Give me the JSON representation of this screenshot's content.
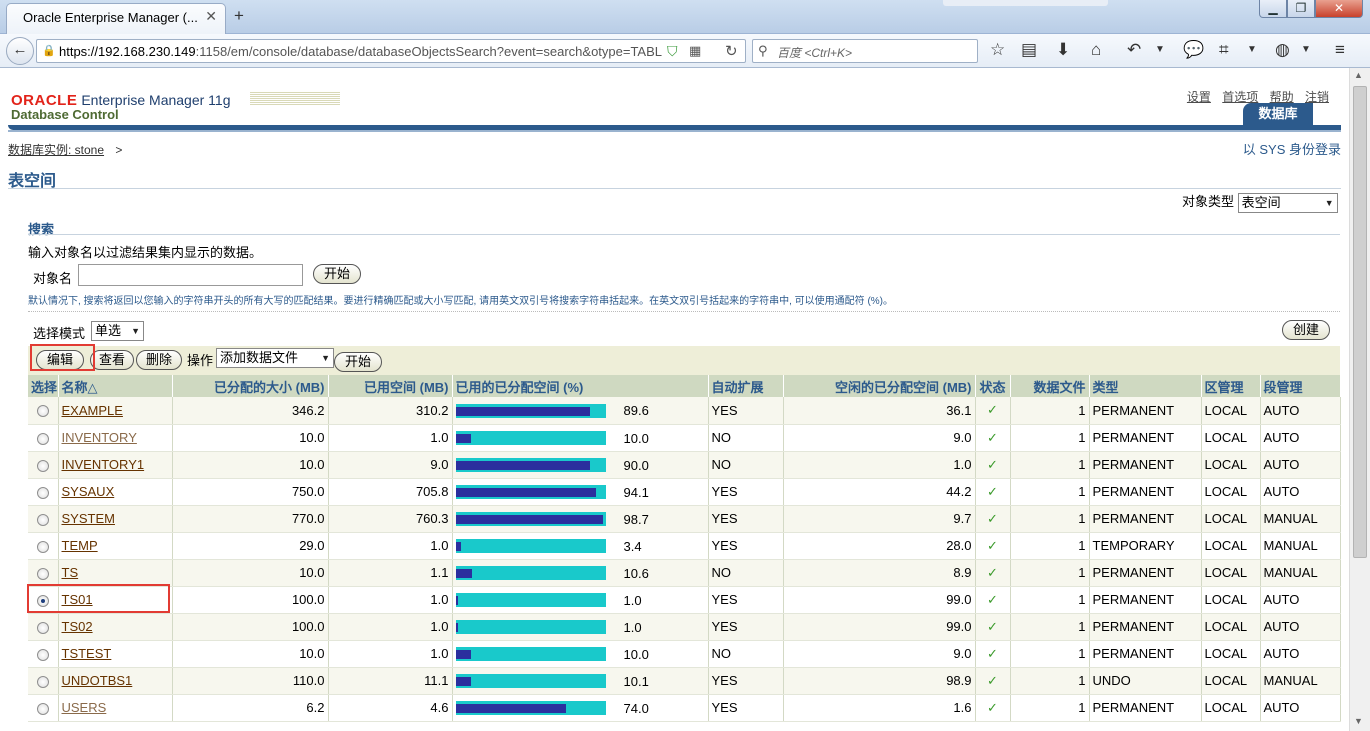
{
  "browser": {
    "tab_title": "Oracle Enterprise Manager (...",
    "url_host": "https://192.168.230.149",
    "url_rest": ":1158/em/console/database/databaseObjectsSearch?event=search&otype=TABL",
    "search_placeholder": "百度 <Ctrl+K>"
  },
  "header": {
    "brand_oracle": "ORACLE",
    "brand_em": "Enterprise Manager 11g",
    "brand_sub": "Database Control",
    "global_links": [
      "设置",
      "首选项",
      "帮助",
      "注销"
    ],
    "db_tab": "数据库"
  },
  "breadcrumb": {
    "link": "数据库实例: stone",
    "sep": ">"
  },
  "login_as": "以 SYS 身份登录",
  "page_title": "表空间",
  "object_type": {
    "label": "对象类型",
    "value": "表空间"
  },
  "search": {
    "title": "搜索",
    "description": "输入对象名以过滤结果集内显示的数据。",
    "name_label": "对象名",
    "name_value": "",
    "go_label": "开始",
    "hint": "默认情况下, 搜索将返回以您输入的字符串开头的所有大写的匹配结果。要进行精确匹配或大小写匹配, 请用英文双引号将搜索字符串括起来。在英文双引号括起来的字符串中, 可以使用通配符 (%)。"
  },
  "selection_mode": {
    "label": "选择模式",
    "value": "单选"
  },
  "buttons": {
    "create": "创建",
    "edit": "编辑",
    "view": "查看",
    "delete": "删除",
    "action_label": "操作",
    "action_value": "添加数据文件",
    "action_go": "开始"
  },
  "table": {
    "headers": [
      "选择",
      "名称△",
      "已分配的大小 (MB)",
      "已用空间 (MB)",
      "已用的已分配空间 (%)",
      "自动扩展",
      "空闲的已分配空间 (MB)",
      "状态",
      "数据文件",
      "类型",
      "区管理",
      "段管理"
    ],
    "rows": [
      {
        "name": "EXAMPLE",
        "allocated": "346.2",
        "used": "310.2",
        "pct": "89.6",
        "pct_value": 89.6,
        "autoext": "YES",
        "free": "36.1",
        "files": "1",
        "type": "PERMANENT",
        "extent": "LOCAL",
        "segment": "AUTO",
        "selected": false
      },
      {
        "name": "INVENTORY",
        "allocated": "10.0",
        "used": "1.0",
        "pct": "10.0",
        "pct_value": 10.0,
        "autoext": "NO",
        "free": "9.0",
        "files": "1",
        "type": "PERMANENT",
        "extent": "LOCAL",
        "segment": "AUTO",
        "selected": false
      },
      {
        "name": "INVENTORY1",
        "allocated": "10.0",
        "used": "9.0",
        "pct": "90.0",
        "pct_value": 90.0,
        "autoext": "NO",
        "free": "1.0",
        "files": "1",
        "type": "PERMANENT",
        "extent": "LOCAL",
        "segment": "AUTO",
        "selected": false
      },
      {
        "name": "SYSAUX",
        "allocated": "750.0",
        "used": "705.8",
        "pct": "94.1",
        "pct_value": 94.1,
        "autoext": "YES",
        "free": "44.2",
        "files": "1",
        "type": "PERMANENT",
        "extent": "LOCAL",
        "segment": "AUTO",
        "selected": false
      },
      {
        "name": "SYSTEM",
        "allocated": "770.0",
        "used": "760.3",
        "pct": "98.7",
        "pct_value": 98.7,
        "autoext": "YES",
        "free": "9.7",
        "files": "1",
        "type": "PERMANENT",
        "extent": "LOCAL",
        "segment": "MANUAL",
        "selected": false
      },
      {
        "name": "TEMP",
        "allocated": "29.0",
        "used": "1.0",
        "pct": "3.4",
        "pct_value": 3.4,
        "autoext": "YES",
        "free": "28.0",
        "files": "1",
        "type": "TEMPORARY",
        "extent": "LOCAL",
        "segment": "MANUAL",
        "selected": false
      },
      {
        "name": "TS",
        "allocated": "10.0",
        "used": "1.1",
        "pct": "10.6",
        "pct_value": 10.6,
        "autoext": "NO",
        "free": "8.9",
        "files": "1",
        "type": "PERMANENT",
        "extent": "LOCAL",
        "segment": "MANUAL",
        "selected": false
      },
      {
        "name": "TS01",
        "allocated": "100.0",
        "used": "1.0",
        "pct": "1.0",
        "pct_value": 1.0,
        "autoext": "YES",
        "free": "99.0",
        "files": "1",
        "type": "PERMANENT",
        "extent": "LOCAL",
        "segment": "AUTO",
        "selected": true
      },
      {
        "name": "TS02",
        "allocated": "100.0",
        "used": "1.0",
        "pct": "1.0",
        "pct_value": 1.0,
        "autoext": "YES",
        "free": "99.0",
        "files": "1",
        "type": "PERMANENT",
        "extent": "LOCAL",
        "segment": "AUTO",
        "selected": false
      },
      {
        "name": "TSTEST",
        "allocated": "10.0",
        "used": "1.0",
        "pct": "10.0",
        "pct_value": 10.0,
        "autoext": "NO",
        "free": "9.0",
        "files": "1",
        "type": "PERMANENT",
        "extent": "LOCAL",
        "segment": "AUTO",
        "selected": false
      },
      {
        "name": "UNDOTBS1",
        "allocated": "110.0",
        "used": "11.1",
        "pct": "10.1",
        "pct_value": 10.1,
        "autoext": "YES",
        "free": "98.9",
        "files": "1",
        "type": "UNDO",
        "extent": "LOCAL",
        "segment": "MANUAL",
        "selected": false
      },
      {
        "name": "USERS",
        "allocated": "6.2",
        "used": "4.6",
        "pct": "74.0",
        "pct_value": 74.0,
        "autoext": "YES",
        "free": "1.6",
        "files": "1",
        "type": "PERMANENT",
        "extent": "LOCAL",
        "segment": "AUTO",
        "selected": false
      }
    ]
  },
  "colors": {
    "brand_blue": "#2c5a8c",
    "gauge_used": "#2b2f9e",
    "gauge_free": "#19c9cb",
    "highlight": "#e23b33"
  }
}
